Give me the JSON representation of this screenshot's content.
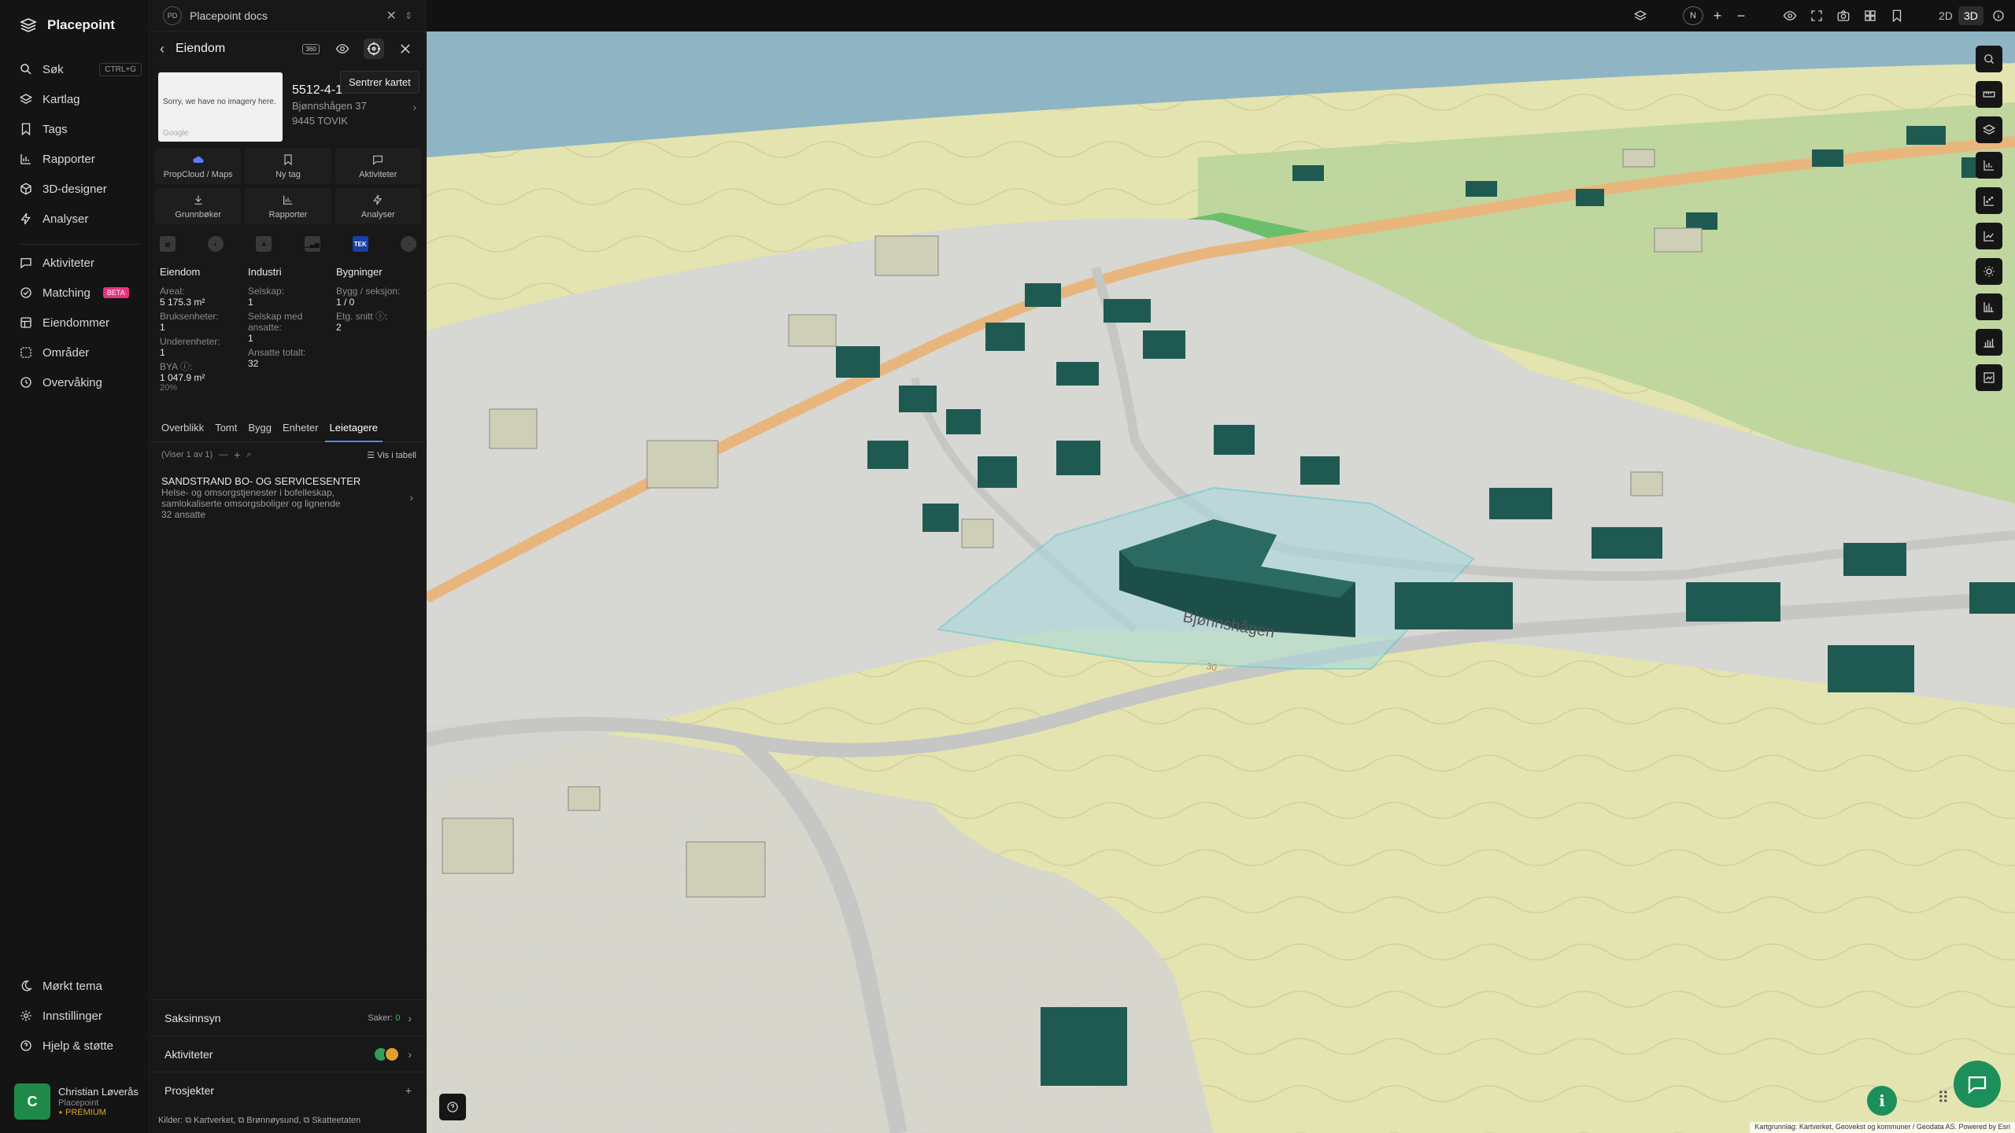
{
  "app": {
    "brand": "Placepoint"
  },
  "nav": {
    "items": [
      {
        "label": "Søk",
        "shortcut": "CTRL+G",
        "icon": "search-icon"
      },
      {
        "label": "Kartlag",
        "icon": "layers-icon"
      },
      {
        "label": "Tags",
        "icon": "bookmark-icon"
      },
      {
        "label": "Rapporter",
        "icon": "chart-icon"
      },
      {
        "label": "3D-designer",
        "icon": "cube-icon"
      },
      {
        "label": "Analyser",
        "icon": "bolt-icon"
      },
      {
        "label": "Aktiviteter",
        "icon": "activity-icon"
      },
      {
        "label": "Matching",
        "badge": "BETA",
        "icon": "matching-icon"
      },
      {
        "label": "Eiendommer",
        "icon": "building-icon"
      },
      {
        "label": "Områder",
        "icon": "area-icon"
      },
      {
        "label": "Overvåking",
        "icon": "monitor-icon"
      }
    ],
    "bottom": [
      {
        "label": "Mørkt tema",
        "icon": "moon-icon"
      },
      {
        "label": "Innstillinger",
        "icon": "gear-icon"
      },
      {
        "label": "Hjelp & støtte",
        "icon": "help-icon"
      }
    ],
    "user": {
      "initial": "C",
      "name": "Christian Løverås",
      "org": "Placepoint",
      "plan": "PREMIUM"
    }
  },
  "panel": {
    "tab_badge": "PD",
    "tab_title": "Placepoint docs",
    "title": "Eiendom",
    "btn_360": "360",
    "tooltip": "Sentrer kartet",
    "thumb_text": "Sorry, we have no imagery here.",
    "thumb_brand": "Google",
    "property_id": "5512-4-137/0/0",
    "address1": "Bjønnshågen 37",
    "address2": "9445 TOVIK",
    "tiles": [
      {
        "label": "PropCloud / Maps",
        "icon": "propcloud-icon"
      },
      {
        "label": "Ny tag",
        "icon": "bookmark-icon"
      },
      {
        "label": "Aktiviteter",
        "icon": "comment-icon"
      },
      {
        "label": "Grunnbøker",
        "icon": "download-icon"
      },
      {
        "label": "Rapporter",
        "icon": "chart-icon"
      },
      {
        "label": "Analyser",
        "icon": "bolt-icon"
      }
    ],
    "layer_tek": "TEK",
    "stats": {
      "eiendom": {
        "header": "Eiendom",
        "areal_label": "Areal:",
        "areal": "5 175.3 m²",
        "bruks_label": "Bruksenheter:",
        "bruks": "1",
        "under_label": "Underenheter:",
        "under": "1",
        "bya_label": "BYA ⓘ:",
        "bya": "1 047.9 m²",
        "bya_pct": "20%"
      },
      "industri": {
        "header": "Industri",
        "selskap_label": "Selskap:",
        "selskap": "1",
        "ansatte_label": "Selskap med ansatte:",
        "ansatte": "1",
        "totalt_label": "Ansatte totalt:",
        "totalt": "32"
      },
      "bygninger": {
        "header": "Bygninger",
        "seksjon_label": "Bygg / seksjon:",
        "seksjon": "1 / 0",
        "etg_label": "Etg. snitt ⓘ:",
        "etg": "2"
      }
    },
    "subtabs": [
      "Overblikk",
      "Tomt",
      "Bygg",
      "Enheter",
      "Leietagere"
    ],
    "active_subtab": "Leietagere",
    "list_count": "(Viser 1 av 1)",
    "list_table": "Vis i tabell",
    "tenant": {
      "name": "SANDSTRAND BO- OG SERVICESENTER",
      "desc": "Helse- og omsorgstjenester i bofelleskap, samlokaliserte omsorgsboliger og lignende",
      "employees": "32 ansatte"
    },
    "saksinnsyn": {
      "label": "Saksinnsyn",
      "meta_label": "Saker:",
      "meta_value": "0"
    },
    "aktiviteter": {
      "label": "Aktiviteter"
    },
    "prosjekter": {
      "label": "Prosjekter",
      "action": "+"
    },
    "kilder": "Kilder: ⧉ Kartverket, ⧉ Brønnøysund, ⧉ Skatteetaten"
  },
  "topbar": {
    "north": "N",
    "plus": "+",
    "minus": "−",
    "mode2d": "2D",
    "mode3d": "3D",
    "active_mode": "3D"
  },
  "map": {
    "street_label": "Bjønnshågen",
    "contour_label": "30",
    "attribution": "Kartgrunnlag: Kartverket, Geovekst og kommuner / Geodata AS. Powered by Esri",
    "colors": {
      "sea": "#8fb4c3",
      "field": "#e5e6b3",
      "grass": "#b8d39a",
      "road": "#cfcfcf",
      "building": "#1d4f49",
      "selection": "#a9d8dc"
    }
  }
}
